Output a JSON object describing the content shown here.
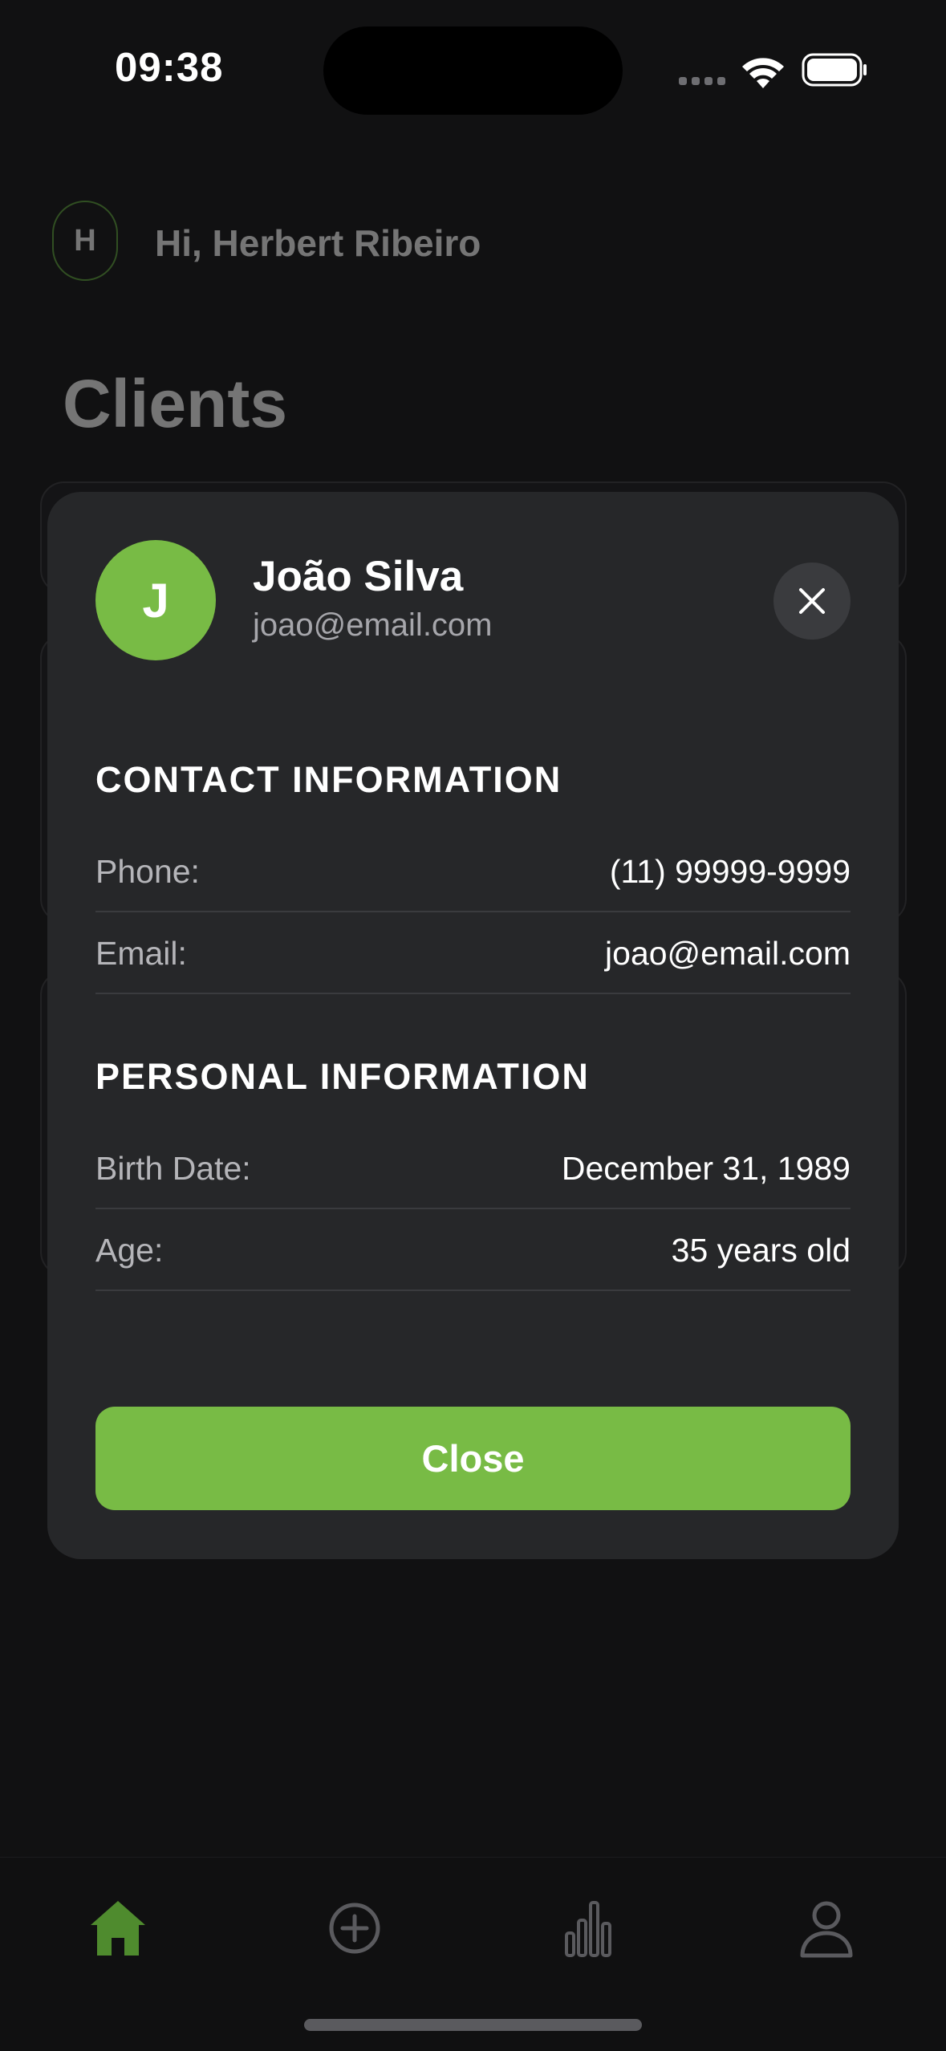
{
  "status_bar": {
    "time": "09:38"
  },
  "header": {
    "avatar_initial": "H",
    "greeting": "Hi, Herbert Ribeiro"
  },
  "page": {
    "title": "Clients"
  },
  "modal": {
    "avatar_initial": "J",
    "name": "João Silva",
    "email": "joao@email.com",
    "contact_section": {
      "title": "CONTACT INFORMATION",
      "rows": [
        {
          "label": "Phone:",
          "value": "(11) 99999-9999"
        },
        {
          "label": "Email:",
          "value": "joao@email.com"
        }
      ]
    },
    "personal_section": {
      "title": "PERSONAL INFORMATION",
      "rows": [
        {
          "label": "Birth Date:",
          "value": "December 31, 1989"
        },
        {
          "label": "Age:",
          "value": "35 years old"
        }
      ]
    },
    "close_label": "Close"
  },
  "tabbar": {
    "items": [
      {
        "icon": "home-icon",
        "active": true
      },
      {
        "icon": "plus-circle-icon",
        "active": false
      },
      {
        "icon": "bar-chart-icon",
        "active": false
      },
      {
        "icon": "user-icon",
        "active": false
      }
    ]
  },
  "colors": {
    "accent": "#78BB45",
    "background": "#111112",
    "modal": "#262729",
    "tab_active": "#4F8B2E",
    "tab_inactive": "#5A5A5E"
  }
}
